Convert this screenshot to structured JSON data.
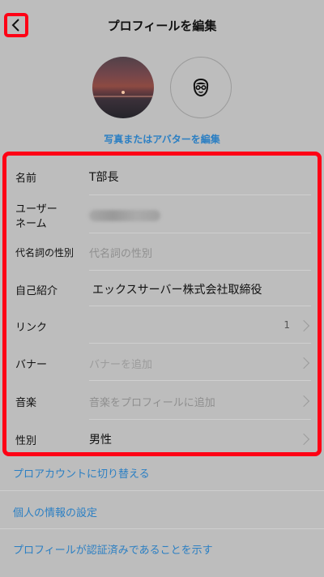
{
  "header": {
    "title": "プロフィールを編集"
  },
  "avatar": {
    "edit_link": "写真またはアバターを編集"
  },
  "form": {
    "name": {
      "label": "名前",
      "value": "T部長"
    },
    "username": {
      "label_line1": "ユーザー",
      "label_line2": "ネーム"
    },
    "pronouns": {
      "label": "代名詞の性別",
      "placeholder": "代名詞の性別"
    },
    "bio": {
      "label": "自己紹介",
      "value": "エックスサーバー株式会社取締役"
    },
    "links": {
      "label": "リンク",
      "count": "1"
    },
    "banner": {
      "label": "バナー",
      "placeholder": "バナーを追加"
    },
    "music": {
      "label": "音楽",
      "placeholder": "音楽をプロフィールに追加"
    },
    "gender": {
      "label": "性別",
      "value": "男性"
    }
  },
  "links": {
    "switch_pro": "プロアカウントに切り替える",
    "personal_info": "個人の情報の設定",
    "verified": "プロフィールが認証済みであることを示す"
  },
  "colors": {
    "accent": "#2b7fc3",
    "highlight": "#ff0015",
    "background": "#bdbdbd"
  }
}
